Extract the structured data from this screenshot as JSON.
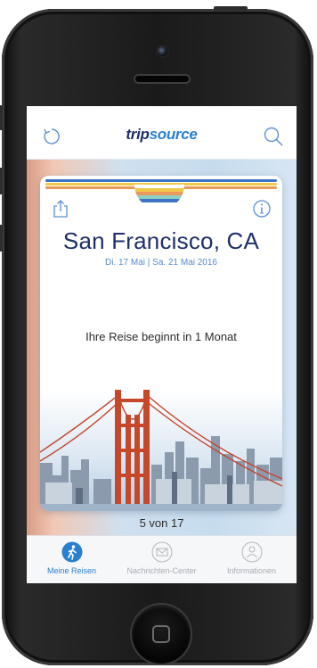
{
  "header": {
    "brand_prefix": "trip",
    "brand_suffix": "source",
    "refresh_icon": "refresh-icon",
    "search_icon": "search-icon"
  },
  "trip_card": {
    "city": "San Francisco, CA",
    "dates": "Di. 17 Mai | Sa. 21 Mai 2016",
    "countdown": "Ihre Reise beginnt in 1 Monat",
    "share_icon": "share-icon",
    "info_icon": "info-icon",
    "image": "golden-gate-bridge-skyline"
  },
  "pager": {
    "label": "5 von 17"
  },
  "tabbar": {
    "tabs": [
      {
        "label": "Meine Reisen",
        "icon": "walking-person-icon",
        "active": true
      },
      {
        "label": "Nachrichten-Center",
        "icon": "envelope-icon",
        "active": false
      },
      {
        "label": "Informationen",
        "icon": "people-icon",
        "active": false
      }
    ]
  },
  "colors": {
    "brand_dark": "#1f2f6b",
    "brand_blue": "#2a7fce",
    "stripe_colors": [
      "#3b74c4",
      "#f0c84a",
      "#e89a5a",
      "#8ed0c4"
    ]
  }
}
